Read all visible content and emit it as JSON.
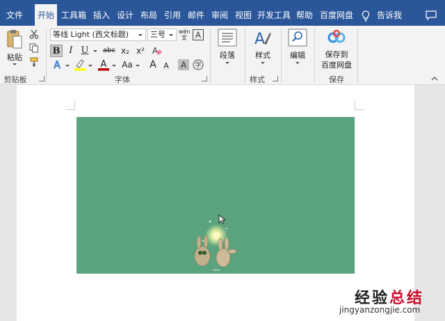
{
  "menubar": {
    "tabs": [
      "文件",
      "开始",
      "工具箱",
      "插入",
      "设计",
      "布局",
      "引用",
      "邮件",
      "审阅",
      "视图",
      "开发工具",
      "帮助",
      "百度网盘"
    ],
    "active_tab": "开始",
    "tell_me": "告诉我"
  },
  "ribbon": {
    "clipboard": {
      "paste": "粘贴",
      "group_label": "剪贴板"
    },
    "font": {
      "font_name": "等线 Light (西文标题)",
      "font_size": "三号",
      "phonetic": "wén\n文",
      "bold": "B",
      "italic": "I",
      "underline": "U",
      "strikethrough": "abc",
      "subscript": "x₂",
      "superscript": "x²",
      "grow": "A",
      "shrink": "A",
      "change_case": "Aa",
      "group_label": "字体",
      "colors": {
        "highlight": "#ffff00",
        "font_color": "#c00000"
      }
    },
    "paragraph": {
      "label": "段落"
    },
    "styles": {
      "label": "样式",
      "group_label": "样式"
    },
    "editing": {
      "label": "编辑"
    },
    "save": {
      "label_line1": "保存到",
      "label_line2": "百度网盘",
      "group_label": "保存"
    }
  },
  "document": {
    "image_background": "#5aa37d"
  },
  "watermark": {
    "title_a": "经验",
    "title_b": "总结",
    "url": "jingyanzongjie.com"
  },
  "colors": {
    "menubar_bg": "#2b579a",
    "ribbon_bg": "#f3f3f3",
    "doc_bg": "#e6e6e6"
  }
}
